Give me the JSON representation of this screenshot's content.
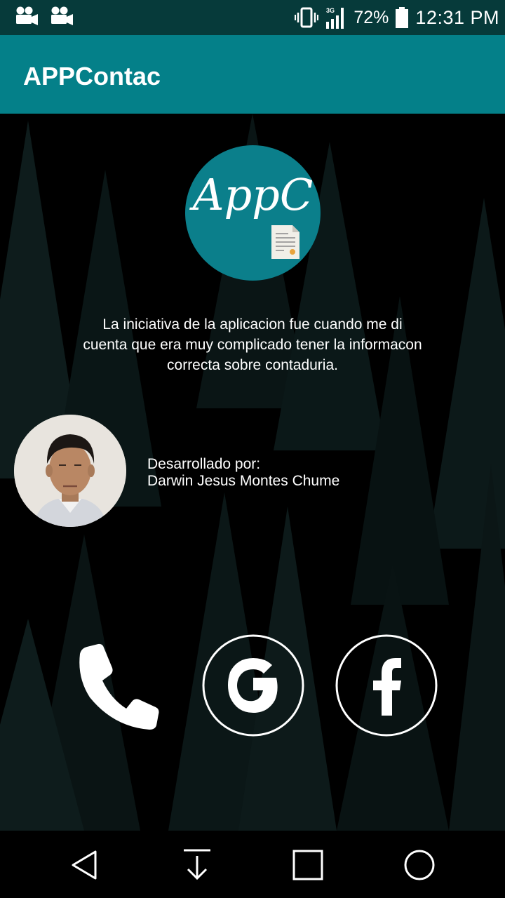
{
  "status_bar": {
    "battery": "72%",
    "time": "12:31 PM",
    "network": "3G",
    "icons": [
      "video-camera-icon",
      "video-camera-icon",
      "vibrate-icon",
      "signal-icon",
      "battery-icon"
    ]
  },
  "app_bar": {
    "title": "APPContac"
  },
  "logo": {
    "text": "AppC"
  },
  "intro": {
    "line1": "La iniciativa de la aplicacion fue cuando me di",
    "line2": "cuenta que era muy complicado tener la informacon",
    "line3": "correcta sobre contaduria."
  },
  "developer": {
    "label": "Desarrollado por:",
    "name": "Darwin Jesus Montes Chume"
  },
  "actions": [
    "phone-icon",
    "google-icon",
    "facebook-icon"
  ],
  "nav": [
    "back-icon",
    "download-icon",
    "recent-apps-icon",
    "home-icon"
  ],
  "colors": {
    "status_bar": "#063a3a",
    "app_bar": "#048089",
    "logo_bg": "#0b7f8b",
    "background": "#000000"
  }
}
